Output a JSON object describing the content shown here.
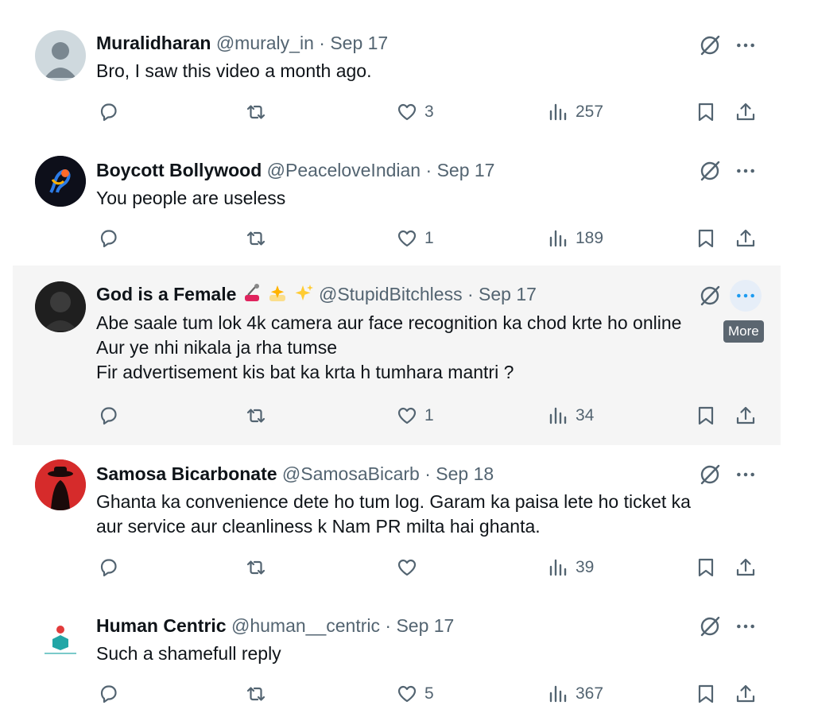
{
  "tweets": [
    {
      "name": "Muralidharan",
      "handle": "@muraly_in",
      "date": "Sep 17",
      "lines": [
        "Bro, I saw this video a month ago."
      ],
      "replies": "",
      "reposts": "",
      "likes": "3",
      "views": "257"
    },
    {
      "name": "Boycott Bollywood",
      "handle": "@PeaceloveIndian",
      "date": "Sep 17",
      "lines": [
        "You people are useless"
      ],
      "replies": "",
      "reposts": "",
      "likes": "1",
      "views": "189"
    },
    {
      "name": "God is a Female",
      "handle": "@StupidBitchless",
      "date": "Sep 17",
      "lines": [
        "Abe saale tum lok 4k camera aur face recognition ka chod krte ho online",
        "Aur ye nhi nikala ja rha tumse",
        "Fir advertisement kis bat ka krta h tumhara mantri ?"
      ],
      "replies": "",
      "reposts": "",
      "likes": "1",
      "views": "34"
    },
    {
      "name": "Samosa Bicarbonate",
      "handle": "@SamosaBicarb",
      "date": "Sep 18",
      "lines": [
        "Ghanta ka convenience dete ho tum log. Garam ka paisa lete ho ticket ka",
        "aur service aur cleanliness k Nam PR milta hai ghanta."
      ],
      "replies": "",
      "reposts": "",
      "likes": "",
      "views": "39"
    },
    {
      "name": "Human Centric",
      "handle": "@human__centric",
      "date": "Sep 17",
      "lines": [
        "Such a shamefull reply"
      ],
      "replies": "",
      "reposts": "",
      "likes": "5",
      "views": "367"
    }
  ],
  "separator": "·",
  "tooltip": "More",
  "icons": {
    "reply": "reply-icon",
    "repost": "repost-icon",
    "like": "heart-icon",
    "views": "views-icon",
    "bookmark": "bookmark-icon",
    "share": "share-icon",
    "grok": "grok-icon",
    "more": "more-icon"
  },
  "colors": {
    "text": "#0f1419",
    "secondary": "#536471",
    "hover_bg": "#f5f5f5",
    "accent": "#1d9bf0",
    "tooltip_bg": "#5b6670"
  }
}
